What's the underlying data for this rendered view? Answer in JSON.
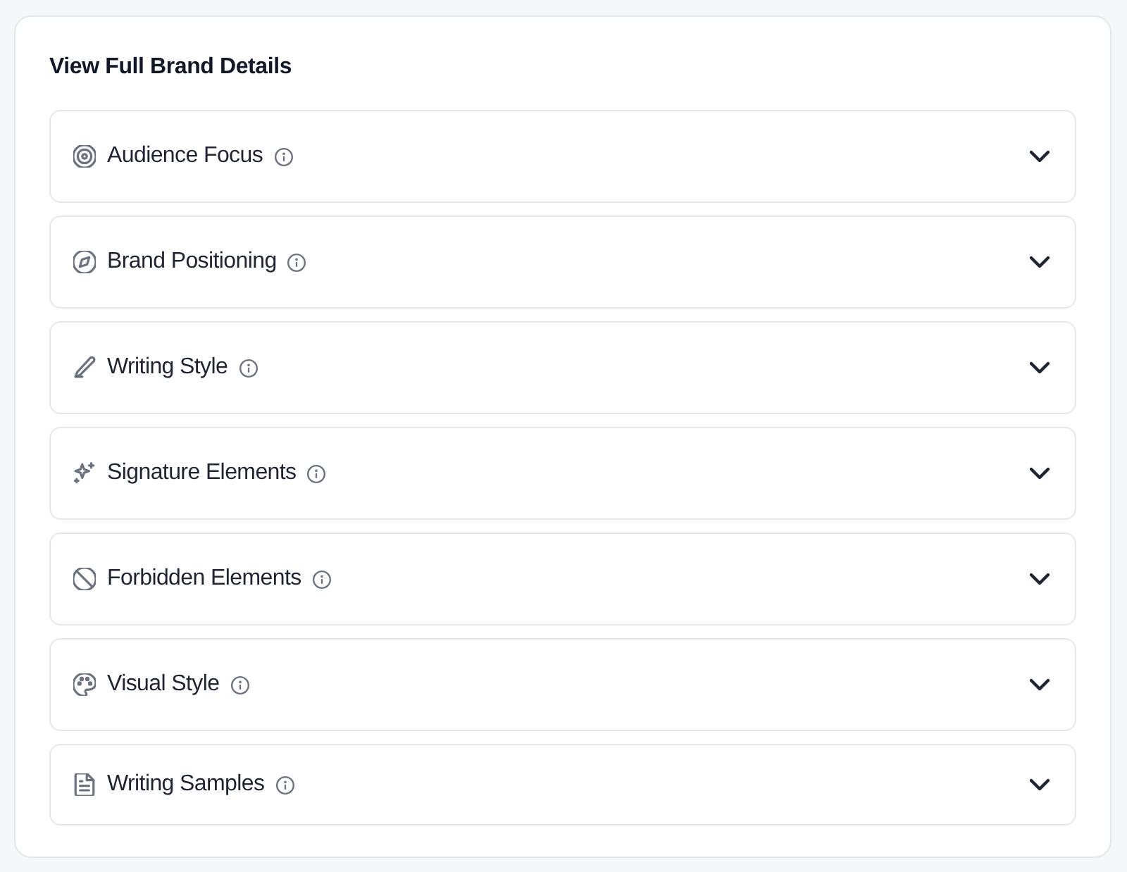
{
  "panel": {
    "title": "View Full Brand Details"
  },
  "sections": [
    {
      "label": "Audience Focus",
      "expanded": false
    },
    {
      "label": "Brand Positioning",
      "expanded": false
    },
    {
      "label": "Writing Style",
      "expanded": false
    },
    {
      "label": "Signature Elements",
      "expanded": false
    },
    {
      "label": "Forbidden Elements",
      "expanded": false
    },
    {
      "label": "Visual Style",
      "expanded": false
    },
    {
      "label": "Writing Samples",
      "expanded": false
    }
  ]
}
